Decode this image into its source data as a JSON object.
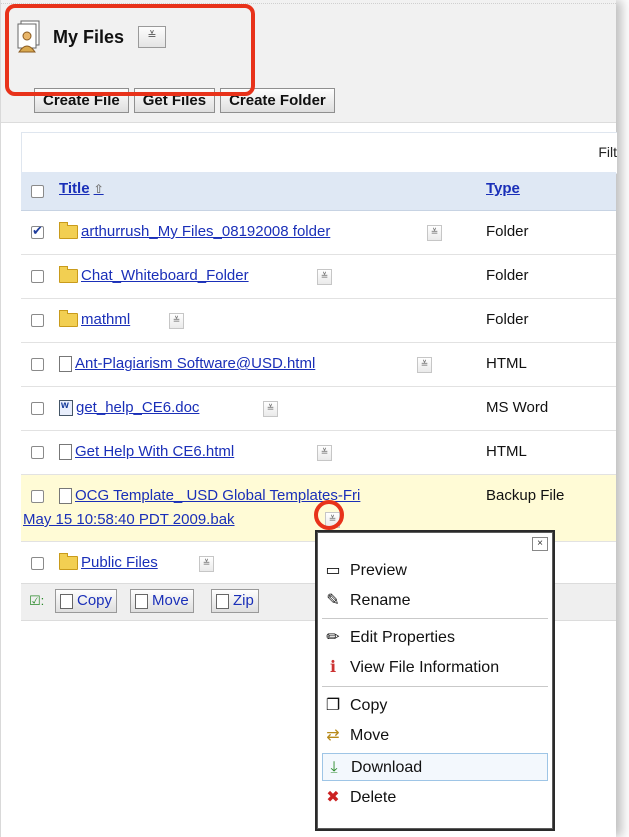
{
  "header": {
    "title": "My Files",
    "menu_glyph": "≚"
  },
  "toolbar": {
    "create_file": "Create File",
    "get_files": "Get Files",
    "create_folder": "Create Folder"
  },
  "filter_label": "Filt",
  "table": {
    "col_title": "Title",
    "col_type": "Type",
    "rows": [
      {
        "name": "arthurrush_My Files_08192008 folder",
        "type": "Folder",
        "icon": "folder-icon",
        "checked": true
      },
      {
        "name": "Chat_Whiteboard_Folder",
        "type": "Folder",
        "icon": "folder-icon",
        "checked": false
      },
      {
        "name": "mathml",
        "type": "Folder",
        "icon": "folder-icon",
        "checked": false
      },
      {
        "name": "Ant-Plagiarism Software@USD.html",
        "type": "HTML",
        "icon": "page-icon",
        "checked": false
      },
      {
        "name": "get_help_CE6.doc",
        "type": "MS Word",
        "icon": "word-icon",
        "checked": false
      },
      {
        "name": "Get Help With CE6.html",
        "type": "HTML",
        "icon": "page-icon",
        "checked": false
      },
      {
        "name_line1": "OCG Template_ USD Global Templates-Fri",
        "name_line2": "May 15 10:58:40 PDT 2009.bak",
        "type": "Backup File",
        "icon": "page-icon",
        "checked": false
      },
      {
        "name": "Public Files",
        "type": "",
        "icon": "folder-icon",
        "checked": false
      }
    ]
  },
  "footer": {
    "copy": "Copy",
    "move": "Move",
    "zip": "Zip"
  },
  "context_menu": {
    "close": "×",
    "items": [
      {
        "label": "Preview",
        "icon": "preview-icon"
      },
      {
        "label": "Rename",
        "icon": "rename-icon"
      },
      {
        "label": "Edit Properties",
        "icon": "pencil-icon"
      },
      {
        "label": "View File Information",
        "icon": "info-icon"
      },
      {
        "label": "Copy",
        "icon": "copy-icon"
      },
      {
        "label": "Move",
        "icon": "move-icon"
      },
      {
        "label": "Download",
        "icon": "download-icon"
      },
      {
        "label": "Delete",
        "icon": "delete-icon"
      }
    ]
  },
  "colors": {
    "highlight": "#e8321a",
    "link": "#1a2fb8",
    "header_bg": "#dfe8f4",
    "selected_row_bg": "#fffbd6"
  }
}
